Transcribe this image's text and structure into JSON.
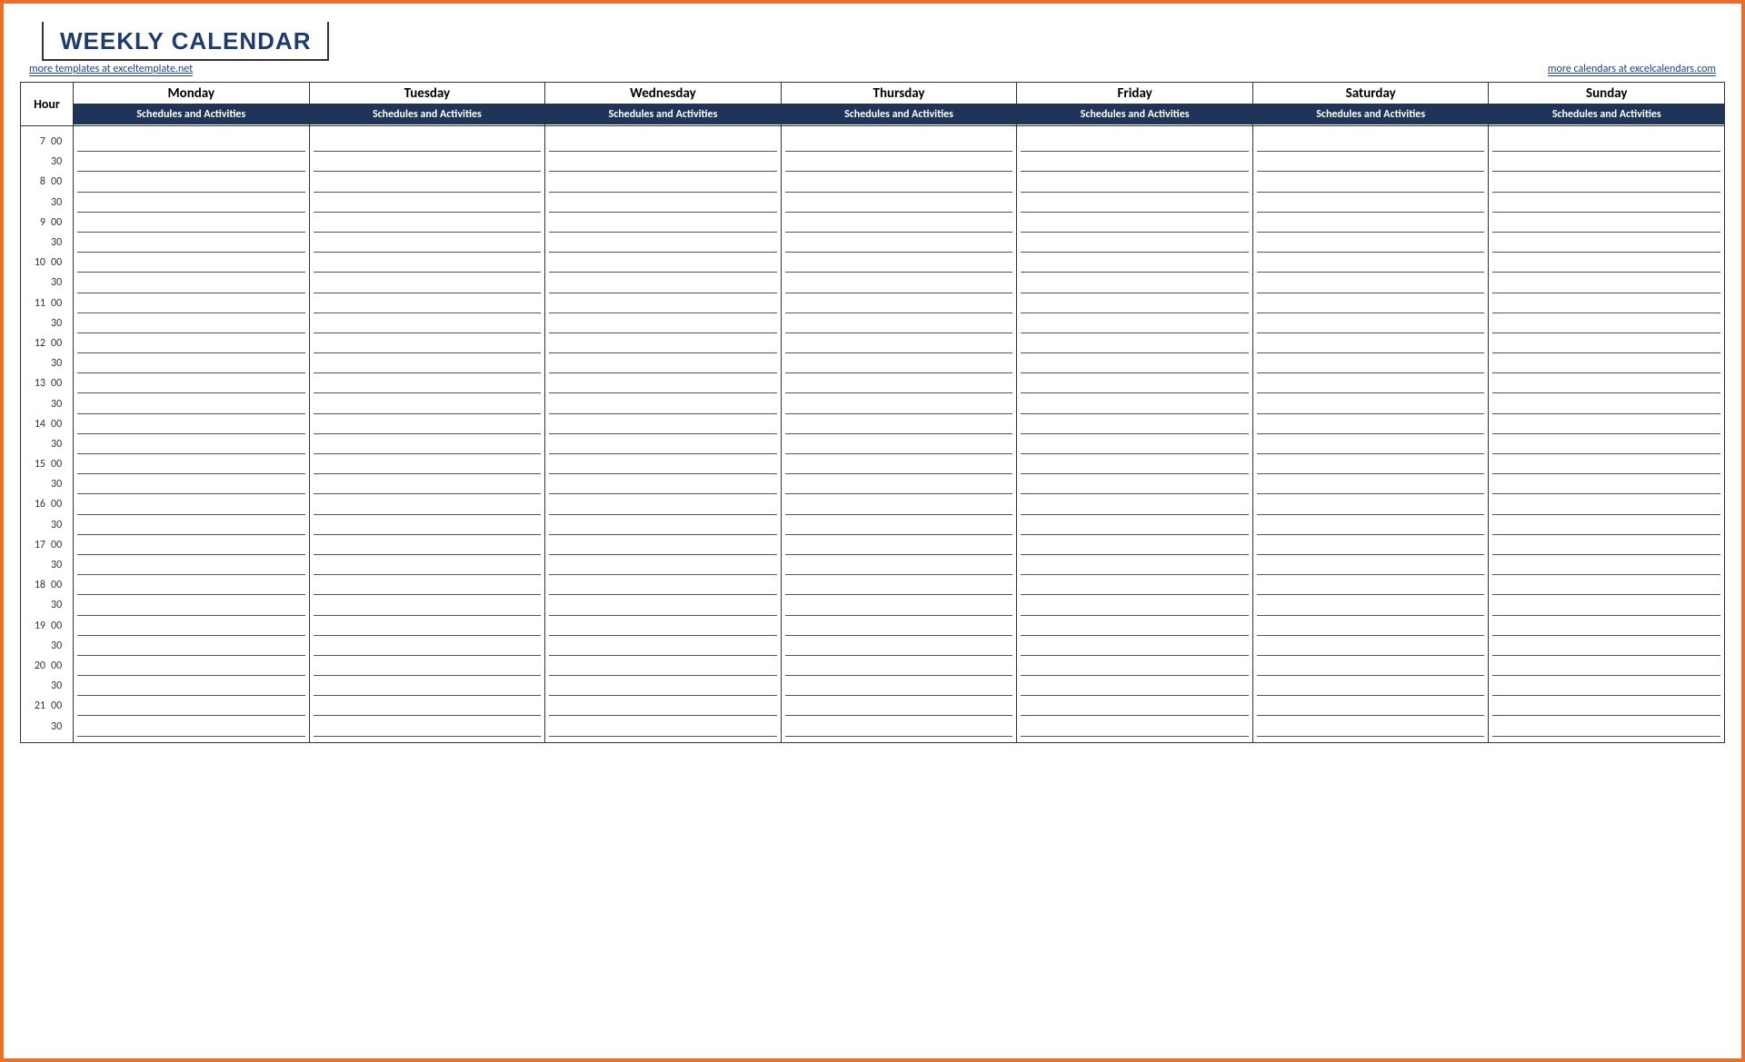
{
  "title": "WEEKLY CALENDAR",
  "links": {
    "left": "more templates at exceltemplate.net",
    "right": "more calendars at excelcalendars.com"
  },
  "hour_label": "Hour",
  "sub_header": "Schedules and Activities",
  "days": [
    "Monday",
    "Tuesday",
    "Wednesday",
    "Thursday",
    "Friday",
    "Saturday",
    "Sunday"
  ],
  "time_rows": [
    {
      "hr": "7",
      "mn": "00"
    },
    {
      "hr": "",
      "mn": "30"
    },
    {
      "hr": "8",
      "mn": "00"
    },
    {
      "hr": "",
      "mn": "30"
    },
    {
      "hr": "9",
      "mn": "00"
    },
    {
      "hr": "",
      "mn": "30"
    },
    {
      "hr": "10",
      "mn": "00"
    },
    {
      "hr": "",
      "mn": "30"
    },
    {
      "hr": "11",
      "mn": "00"
    },
    {
      "hr": "",
      "mn": "30"
    },
    {
      "hr": "12",
      "mn": "00"
    },
    {
      "hr": "",
      "mn": "30"
    },
    {
      "hr": "13",
      "mn": "00"
    },
    {
      "hr": "",
      "mn": "30"
    },
    {
      "hr": "14",
      "mn": "00"
    },
    {
      "hr": "",
      "mn": "30"
    },
    {
      "hr": "15",
      "mn": "00"
    },
    {
      "hr": "",
      "mn": "30"
    },
    {
      "hr": "16",
      "mn": "00"
    },
    {
      "hr": "",
      "mn": "30"
    },
    {
      "hr": "17",
      "mn": "00"
    },
    {
      "hr": "",
      "mn": "30"
    },
    {
      "hr": "18",
      "mn": "00"
    },
    {
      "hr": "",
      "mn": "30"
    },
    {
      "hr": "19",
      "mn": "00"
    },
    {
      "hr": "",
      "mn": "30"
    },
    {
      "hr": "20",
      "mn": "00"
    },
    {
      "hr": "",
      "mn": "30"
    },
    {
      "hr": "21",
      "mn": "00"
    },
    {
      "hr": "",
      "mn": "30"
    }
  ]
}
